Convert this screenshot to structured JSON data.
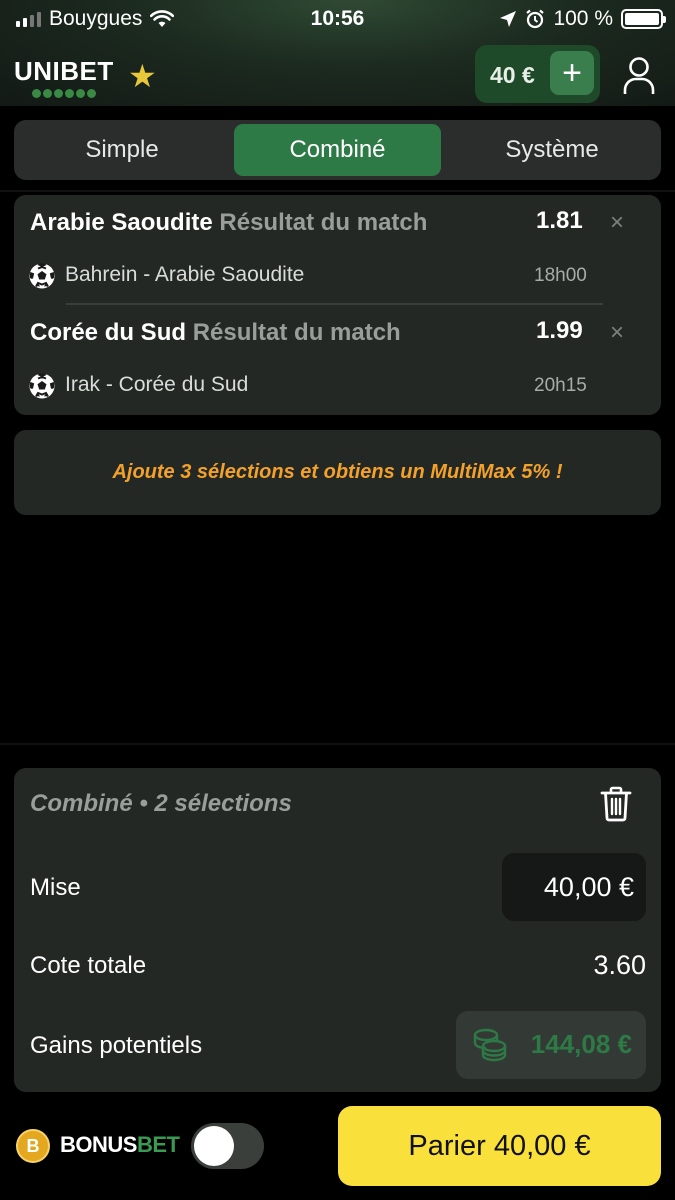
{
  "status_bar": {
    "carrier": "Bouygues",
    "time": "10:56",
    "battery": "100 %"
  },
  "header": {
    "logo": "UNIBET",
    "balance": "40 €",
    "add_label": "+"
  },
  "tabs": [
    {
      "label": "Simple",
      "active": false
    },
    {
      "label": "Combiné",
      "active": true
    },
    {
      "label": "Système",
      "active": false
    }
  ],
  "selections": [
    {
      "team": "Arabie Saoudite",
      "market": "Résultat du match",
      "odds": "1.81",
      "event": "Bahrein - Arabie Saoudite",
      "time": "18h00"
    },
    {
      "team": "Corée du Sud",
      "market": "Résultat du match",
      "odds": "1.99",
      "event": "Irak - Corée du Sud",
      "time": "20h15"
    }
  ],
  "promo": {
    "text": "Ajoute 3 sélections et obtiens un MultiMax 5% !"
  },
  "summary": {
    "title": "Combiné • 2 sélections",
    "stake_label": "Mise",
    "stake_value": "40,00 €",
    "odds_label": "Cote totale",
    "odds_value": "3.60",
    "gains_label": "Gains potentiels",
    "gains_value": "144,08 €"
  },
  "footer": {
    "bonus_coin": "B",
    "bonus_word": "BONUS",
    "bet_word": "BET",
    "bet_button": "Parier 40,00 €"
  },
  "colors": {
    "accent_green": "#2e7a46",
    "bet_button_yellow": "#f9e03a",
    "promo_orange": "#f3a12a"
  }
}
